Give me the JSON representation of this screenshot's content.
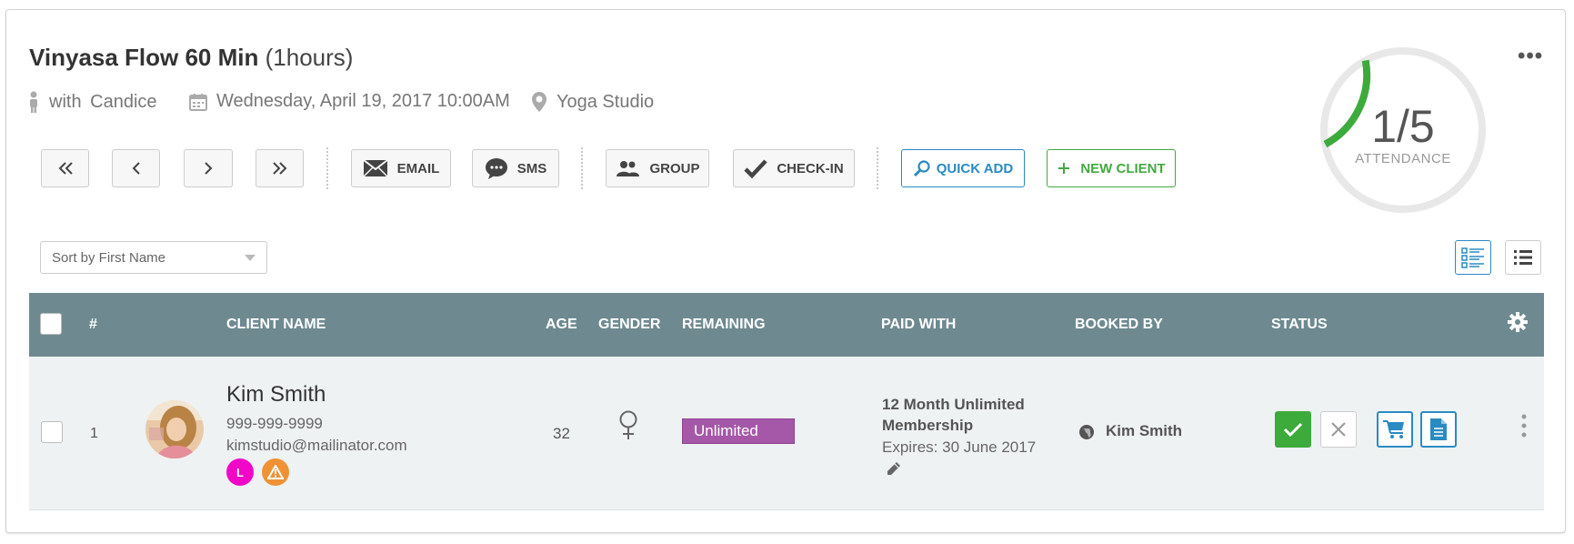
{
  "header": {
    "class_name": "Vinyasa Flow 60 Min",
    "duration": "(1hours)",
    "with_label": "with",
    "instructor": "Candice",
    "datetime": "Wednesday, April 19, 2017 10:00AM",
    "location": "Yoga Studio",
    "more_icon": "ellipsis-icon"
  },
  "toolbar": {
    "email_label": "EMAIL",
    "sms_label": "SMS",
    "group_label": "GROUP",
    "checkin_label": "CHECK-IN",
    "quick_add_label": "QUICK ADD",
    "new_client_label": "NEW CLIENT"
  },
  "attendance": {
    "value": "1/5",
    "label": "ATTENDANCE",
    "fraction": 0.2,
    "color": "#3daa3c"
  },
  "sort": {
    "selected": "Sort by First Name"
  },
  "table": {
    "columns": {
      "num": "#",
      "client_name": "CLIENT NAME",
      "age": "AGE",
      "gender": "GENDER",
      "remaining": "REMAINING",
      "paid_with": "PAID WITH",
      "booked_by": "BOOKED BY",
      "status": "STATUS"
    },
    "header_color": "#6e8a90",
    "rows": [
      {
        "num": "1",
        "name": "Kim Smith",
        "phone": "999-999-9999",
        "email": "kimstudio@mailinator.com",
        "badge_letter": "L",
        "badge_color": "#f007c8",
        "alert_color": "#ef9234",
        "age": "32",
        "gender_icon": "female-icon",
        "remaining": "Unlimited",
        "remaining_color": "#a557a8",
        "paid_with_line1": "12 Month Unlimited",
        "paid_with_line2": "Membership",
        "expires": "Expires: 30 June 2017",
        "booked_by": "Kim Smith",
        "status_checked_color": "#3daa3c"
      }
    ]
  },
  "colors": {
    "accent_blue": "#2a8ac2",
    "accent_green": "#44a843"
  }
}
